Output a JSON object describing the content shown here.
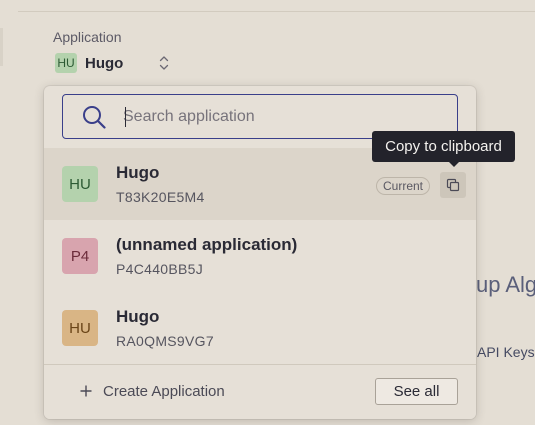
{
  "header": {
    "application_label": "Application",
    "current_app": {
      "initials": "HU",
      "name": "Hugo",
      "color": "#b4d2ad"
    }
  },
  "search": {
    "placeholder": "Search application",
    "value": ""
  },
  "applications": [
    {
      "initials": "HU",
      "name": "Hugo",
      "id": "T83K20E5M4",
      "color": "#b4d2ad",
      "current": true
    },
    {
      "initials": "P4",
      "name": "(unnamed application)",
      "id": "P4C440BB5J",
      "color": "#d8a4ae",
      "current": false
    },
    {
      "initials": "HU",
      "name": "Hugo",
      "id": "RA0QMS9VG7",
      "color": "#d9b585",
      "current": false
    }
  ],
  "current_tag": "Current",
  "tooltip": "Copy to clipboard",
  "footer": {
    "create_label": "Create Application",
    "see_all_label": "See all"
  },
  "background": {
    "heading_fragment": "up Alg",
    "link_fragment": "API Keys"
  },
  "icons": {
    "updown": "chevron-up-down-icon",
    "search": "search-icon",
    "copy": "copy-icon",
    "plus": "plus-icon"
  },
  "colors": {
    "accent": "#3a3f8a",
    "tooltip_bg": "#23232b"
  }
}
